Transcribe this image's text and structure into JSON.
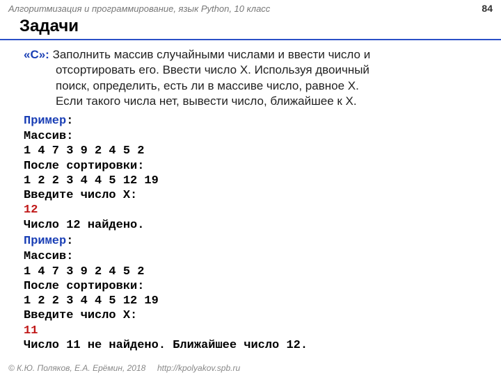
{
  "header": {
    "course": "Алгоритмизация и программирование, язык Python, 10 класс",
    "page": "84"
  },
  "title": "Задачи",
  "task": {
    "label": "«C»:",
    "line1": " Заполнить массив случайными числами и ввести число и",
    "line2": "отсортировать его.  Ввести число X. Используя двоичный",
    "line3": "поиск, определить, есть ли в массиве число, равное X.",
    "line4": "Если такого числа нет, вывести число, ближайшее к X."
  },
  "example1": {
    "label": "Пример",
    "colon": ":",
    "l1": "Массив:",
    "l2": "1 4 7 3 9 2 4 5 2",
    "l3": "После сортировки:",
    "l4": "1 2 2 3 4 4 5 12 19",
    "l5": "Введите число X:",
    "l6": "12",
    "l7": "Число 12 найдено."
  },
  "example2": {
    "label": "Пример",
    "colon": ":",
    "l1": "Массив:",
    "l2": "1 4 7 3 9 2 4 5 2",
    "l3": "После сортировки:",
    "l4": "1 2 2 3 4 4 5 12 19",
    "l5": "Введите число X:",
    "l6": "11",
    "l7": "Число 11 не найдено. Ближайшее число 12."
  },
  "footer": {
    "copyright": "© К.Ю. Поляков, Е.А. Ерёмин, 2018",
    "url": "http://kpolyakov.spb.ru"
  }
}
